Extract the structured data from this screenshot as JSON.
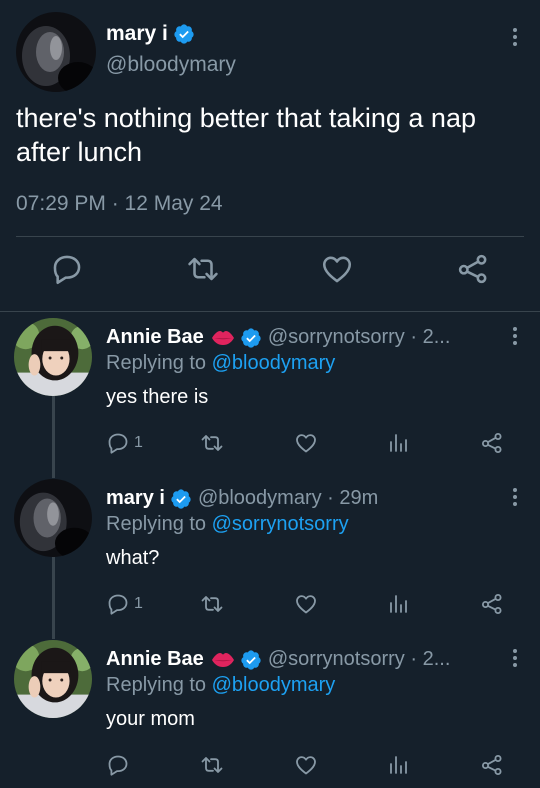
{
  "main_tweet": {
    "name": "mary i",
    "handle": "@bloodymary",
    "text": "there's nothing better that taking a nap after lunch",
    "timestamp": "07:29 PM · 12 May 24",
    "icons": [
      "more-icon",
      "verified-icon",
      "reply-icon",
      "retweet-icon",
      "like-icon",
      "share-icon"
    ]
  },
  "replies": [
    {
      "name": "Annie Bae",
      "emoji": "lips-emoji",
      "handle_meta": "@sorrynotsorry · 2...",
      "replying_prefix": "Replying to ",
      "replying_to": "@bloodymary",
      "text": "yes there is",
      "reply_count": "1"
    },
    {
      "name": "mary i",
      "handle_meta": "@bloodymary · 29m",
      "replying_prefix": "Replying to ",
      "replying_to": "@sorrynotsorry",
      "text": "what?",
      "reply_count": "1"
    },
    {
      "name": "Annie Bae",
      "emoji": "lips-emoji",
      "handle_meta": "@sorrynotsorry · 2...",
      "replying_prefix": "Replying to ",
      "replying_to": "@bloodymary",
      "text": "your mom",
      "reply_count": ""
    }
  ],
  "colors": {
    "background": "#15202b",
    "secondary_text": "#8899a6",
    "accent": "#1da1f2",
    "divider": "#38444d"
  }
}
